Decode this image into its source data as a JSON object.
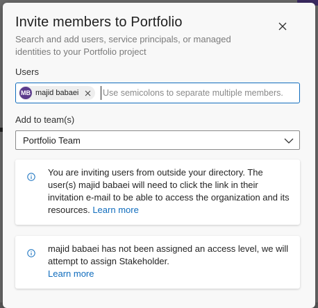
{
  "dialog": {
    "title": "Invite members to Portfolio",
    "subtitle": "Search and add users, service principals, or managed identities to your Portfolio project",
    "close_icon": "close-icon"
  },
  "users": {
    "label": "Users",
    "chip": {
      "initials": "MB",
      "name": "majid babaei",
      "avatar_color": "#5c3c8c"
    },
    "placeholder": "Use semicolons to separate multiple members."
  },
  "team": {
    "label": "Add to team(s)",
    "selected": "Portfolio Team"
  },
  "notices": [
    {
      "icon": "info-icon",
      "text": "You are inviting users from outside your directory. The user(s) majid babaei will need to click the link in their invitation e-mail to be able to access the organization and its resources.",
      "link": "Learn more"
    },
    {
      "icon": "info-icon",
      "text": "majid babaei has not been assigned an access level, we will attempt to assign Stakeholder.",
      "link": "Learn more"
    }
  ],
  "colors": {
    "accent": "#0f6cbd",
    "text": "#242424",
    "muted": "#7a7a7a"
  }
}
